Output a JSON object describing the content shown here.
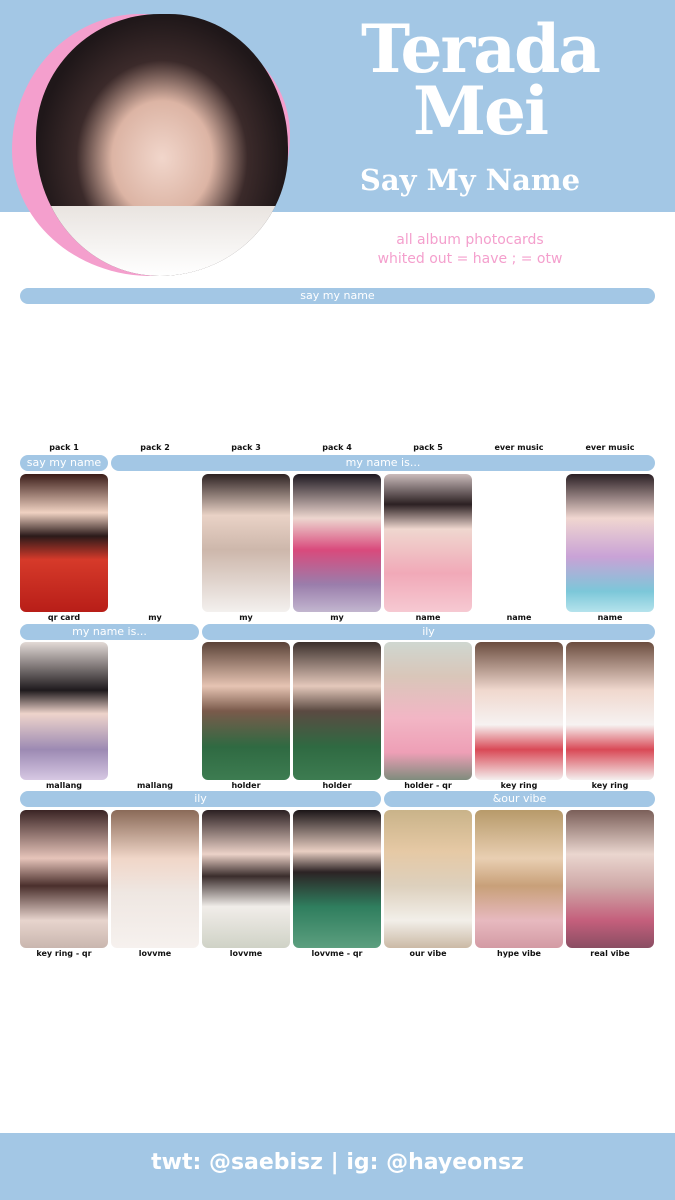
{
  "header": {
    "title_line1": "Terada",
    "title_line2": "Mei",
    "subtitle": "Say My Name",
    "description_line1": "all album photocards",
    "description_line2": "whited out = have ;     = otw"
  },
  "colors": {
    "band": "#a3c7e5",
    "accent_pink": "#f49fcd",
    "text_white": "#ffffff"
  },
  "sections": {
    "album_bar": "say my name",
    "columns": [
      "pack 1",
      "pack 2",
      "pack 3",
      "pack 4",
      "pack 5",
      "ever music",
      "ever music"
    ],
    "row1_left": "say my name",
    "row1_right": "my name is...",
    "row2_left": "my name is...",
    "row2_right": "ily",
    "row3_left": "ily",
    "row3_right": "&our vibe"
  },
  "rows": [
    [
      "qr card",
      "my",
      "my",
      "my",
      "name",
      "name",
      "name"
    ],
    [
      "mallang",
      "mallang",
      "holder",
      "holder",
      "holder - qr",
      "key ring",
      "key ring"
    ],
    [
      "key ring - qr",
      "lovvme",
      "lovvme",
      "lovvme - qr",
      "our vibe",
      "hype vibe",
      "real vibe"
    ]
  ],
  "footer": {
    "text": "twt: @saebisz  |  ig: @hayeonsz"
  }
}
